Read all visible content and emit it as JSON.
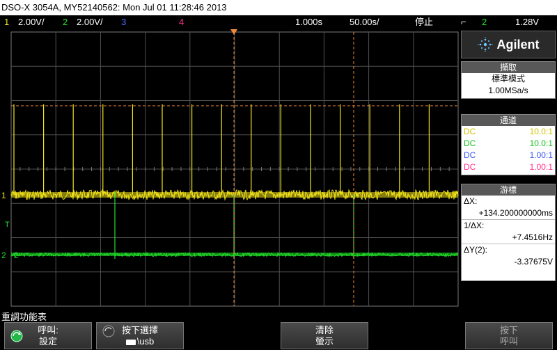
{
  "title_bar": "DSO-X 3054A, MY52140562: Mon Jul 01 11:28:46 2013",
  "status": {
    "ch1_num": "1",
    "ch1_scale": "2.00V/",
    "ch2_num": "2",
    "ch2_scale": "2.00V/",
    "ch3_num": "3",
    "ch4_num": "4",
    "timebase": "1.000s",
    "delay": "50.00s/",
    "run_state": "停止",
    "trigger_source": "2",
    "trigger_level": "1.28V"
  },
  "brand": "Agilent",
  "colors": {
    "ch1": "#f2e41a",
    "ch2": "#22e02a",
    "ch3": "#4f6dff",
    "ch4": "#ff2e8a",
    "grid": "#7a7a7a",
    "cursor": "#f08a3a"
  },
  "acquire": {
    "header": "擷取",
    "mode": "標準模式",
    "rate": "1.00MSa/s"
  },
  "channels": {
    "header": "通道",
    "rows": [
      {
        "coupling": "DC",
        "probe": "10.0:1"
      },
      {
        "coupling": "DC",
        "probe": "10.0:1"
      },
      {
        "coupling": "DC",
        "probe": "1.00:1"
      },
      {
        "coupling": "DC",
        "probe": "1.00:1"
      }
    ]
  },
  "cursors": {
    "header": "游標",
    "dx_label": "ΔX:",
    "dx_value": "+134.200000000ms",
    "inv_dx_label": "1/ΔX:",
    "inv_dx_value": "+7.4516Hz",
    "dy_label": "ΔY(2):",
    "dy_value": "-3.37675V"
  },
  "plot_markers": {
    "ch1": "1",
    "ch2": "2",
    "trig": "T"
  },
  "menu_title": "重調功能表",
  "softkeys": [
    {
      "line1": "呼叫:",
      "line2": "設定"
    },
    {
      "line1": "按下選擇",
      "line2": "\\usb"
    },
    {
      "line1": "清除",
      "line2": "螢示"
    },
    {
      "line1": "按下",
      "line2": "呼叫"
    }
  ]
}
